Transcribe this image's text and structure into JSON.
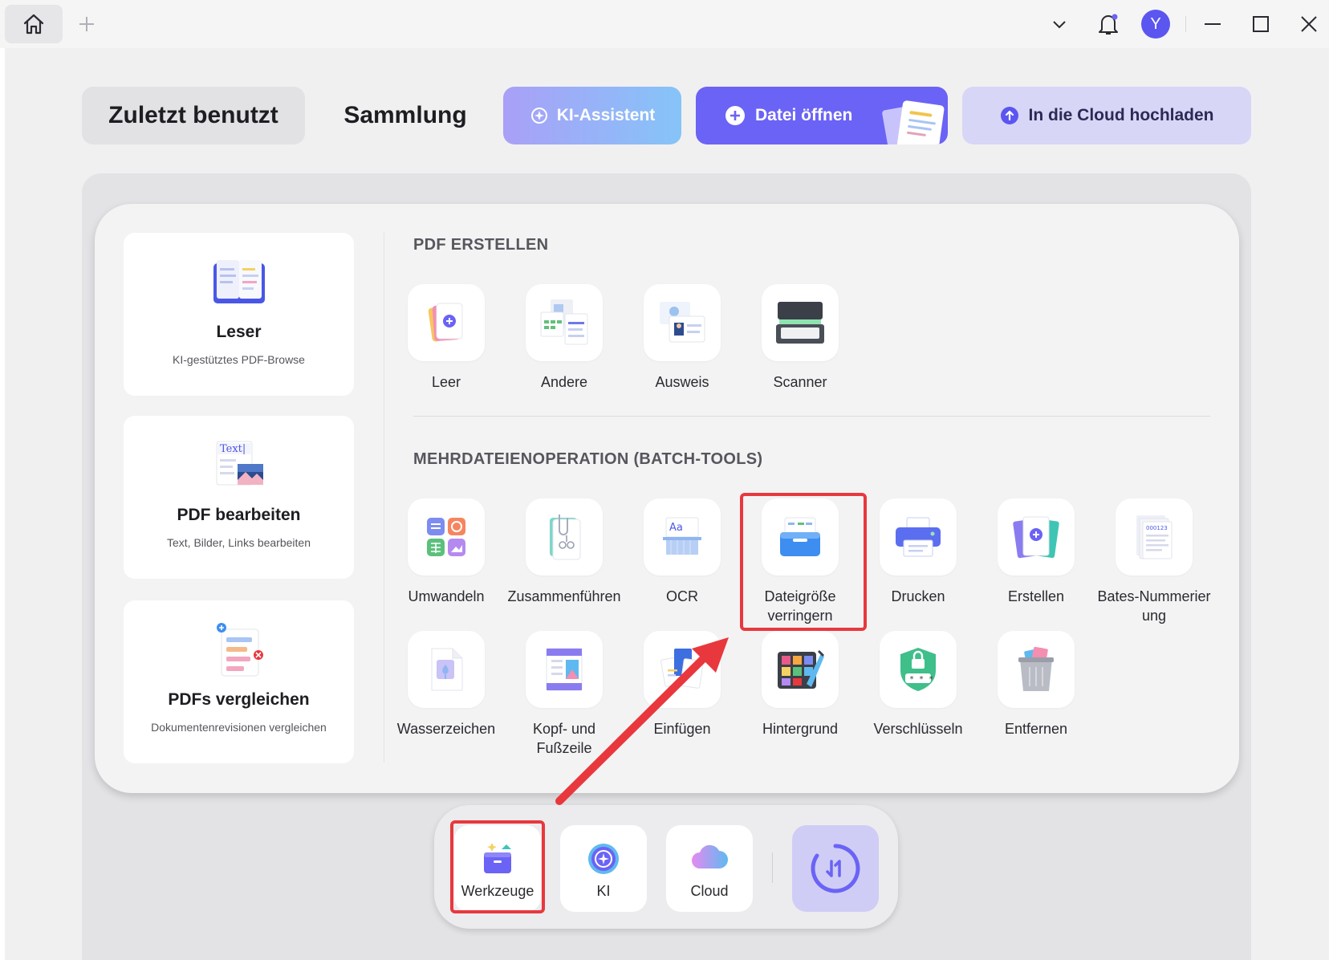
{
  "titlebar": {
    "avatar_letter": "Y"
  },
  "top_tabs": {
    "recent": "Zuletzt benutzt",
    "collection": "Sammlung",
    "ai_assistant": "KI-Assistent",
    "open_file": "Datei öffnen",
    "upload_cloud": "In die Cloud hochladen"
  },
  "left_cards": [
    {
      "title": "Leser",
      "subtitle": "KI-gestütztes PDF-Browse"
    },
    {
      "title": "PDF bearbeiten",
      "subtitle": "Text, Bilder, Links bearbeiten",
      "icon_text": "Text|"
    },
    {
      "title": "PDFs vergleichen",
      "subtitle": "Dokumentenrevisionen vergleichen"
    }
  ],
  "sections": {
    "create_heading": "PDF ERSTELLEN",
    "batch_heading": "MEHRDATEIENOPERATION (BATCH-TOOLS)"
  },
  "create_tools": [
    "Leer",
    "Andere",
    "Ausweis",
    "Scanner"
  ],
  "batch_tools_row1": [
    "Umwandeln",
    "Zusammenführen",
    "OCR",
    "Dateigröße verringern",
    "Drucken",
    "Erstellen",
    "Bates-Nummerier ung"
  ],
  "batch_tools_row2": [
    "Wasserzeichen",
    "Kopf- und Fußzeile",
    "Einfügen",
    "Hintergrund",
    "Verschlüsseln",
    "Entfernen"
  ],
  "icon_texts": {
    "ocr": "Aa",
    "bates": "000123",
    "password": "* * *"
  },
  "dock": {
    "tools": "Werkzeuge",
    "ai": "KI",
    "cloud": "Cloud"
  },
  "colors": {
    "accent": "#6a63f5",
    "highlight": "#e8383d"
  }
}
